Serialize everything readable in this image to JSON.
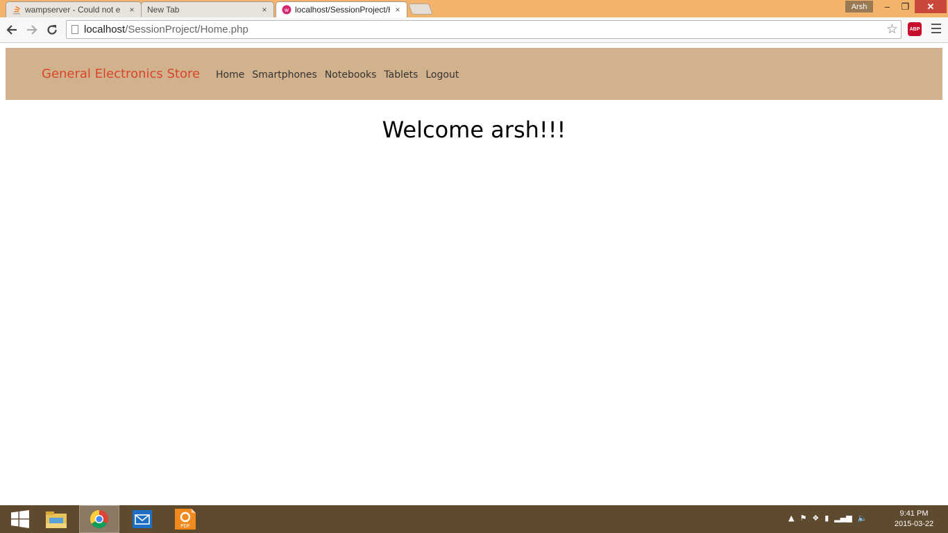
{
  "browser": {
    "tabs": [
      {
        "title": "wampserver - Could not e",
        "icon": "stack-overflow-icon",
        "close": "×"
      },
      {
        "title": "New Tab",
        "icon": "",
        "close": "×"
      },
      {
        "title": "localhost/SessionProject/H",
        "icon": "wamp-icon",
        "close": "×"
      }
    ],
    "profile_name": "Arsh",
    "window_controls": {
      "minimize": "–",
      "restore": "❐",
      "close": "✕"
    },
    "url": {
      "host": "localhost",
      "path": "/SessionProject/Home.php"
    },
    "abp_label": "ABP",
    "accent_color": "#f4b36a"
  },
  "site": {
    "brand": "General Electronics Store",
    "nav": [
      "Home",
      "Smartphones",
      "Notebooks",
      "Tablets",
      "Logout"
    ],
    "welcome": "Welcome arsh!!!",
    "nav_bg_color": "#d1b28c",
    "brand_color": "#d8452b"
  },
  "taskbar": {
    "apps": [
      "file-explorer-icon",
      "chrome-icon",
      "mail-icon",
      "pdf-app-icon"
    ],
    "clock": {
      "time": "9:41 PM",
      "date": "2015-03-22"
    }
  }
}
